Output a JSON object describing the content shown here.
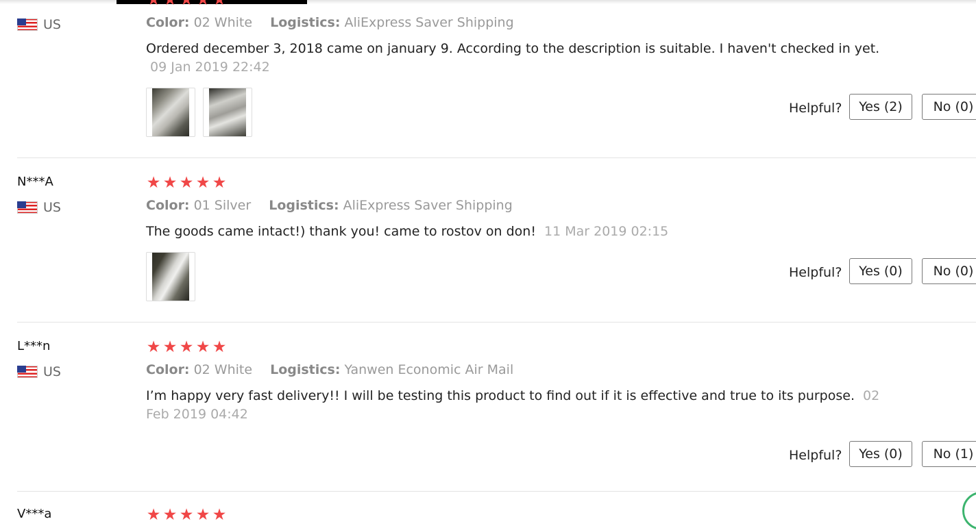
{
  "reviews": [
    {
      "user": "",
      "country": "US",
      "color_label": "Color:",
      "color_value": "02 White",
      "logistics_label": "Logistics:",
      "logistics_value": "AliExpress Saver Shipping",
      "text": "Ordered december 3, 2018 came on january 9. According to the description is suitable. I haven't checked in yet.",
      "date": "09 Jan 2019 22:42",
      "helpful_label": "Helpful?",
      "yes_label": "Yes (2)",
      "no_label": "No (0)"
    },
    {
      "user": "N***A",
      "country": "US",
      "rating": 5,
      "color_label": "Color:",
      "color_value": "01 Silver",
      "logistics_label": "Logistics:",
      "logistics_value": "AliExpress Saver Shipping",
      "text": "The goods came intact!) thank you! came to rostov on don!",
      "date": "11 Mar 2019 02:15",
      "helpful_label": "Helpful?",
      "yes_label": "Yes (0)",
      "no_label": "No (0)"
    },
    {
      "user": "L***n",
      "country": "US",
      "rating": 5,
      "color_label": "Color:",
      "color_value": "02 White",
      "logistics_label": "Logistics:",
      "logistics_value": "Yanwen Economic Air Mail",
      "text": "I’m happy very fast delivery!! I will be testing this product to find out if it is effective and true to its purpose.",
      "date": "02 Feb 2019 04:42",
      "helpful_label": "Helpful?",
      "yes_label": "Yes (0)",
      "no_label": "No (1)"
    },
    {
      "user": "V***a",
      "rating": 5
    }
  ],
  "star_glyph": "★",
  "colors": {
    "star": "#f04747",
    "meta": "#999999",
    "divider": "#e3e3e3"
  }
}
